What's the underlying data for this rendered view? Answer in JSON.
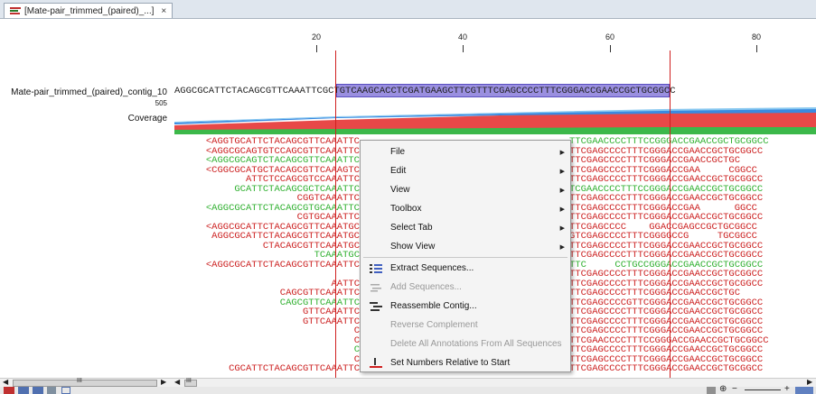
{
  "tab": {
    "title": "[Mate-pair_trimmed_(paired)_...]",
    "close": "×"
  },
  "ruler": {
    "labels": [
      "20",
      "40",
      "60",
      "80"
    ]
  },
  "contig": {
    "name": "Mate-pair_trimmed_(paired)_contig_10",
    "length": "505",
    "sequence": "AGGCGCATTCTACAGCGTTCAAATTCGCTGTCAAGCACCTCGATGAAGCTTCGTTTCGAGCCCCTTTCGGGACCGAACCGCTGCGGCC"
  },
  "coverage_label": "Coverage",
  "reads": [
    {
      "left": "<AGGTGCATTCTACAGCGTTCAAATTC",
      "right": "TTCGAACCCCTTTCCGGGACCGAACCGCTGCGGCC"
    },
    {
      "left": "<AGGCGCAGTGTCCAGCGTTCAAATTC",
      "right": "TTCGAGCCCCTTTCGGGACCGAACCGCTGCGGCC"
    },
    {
      "left": "<AGGCGCAGTCTACAGCGTTCAAATTC",
      "right": "TTCGAGCCCCTTTCGGGACCGAACCGCTGC"
    },
    {
      "left": "<CGGCGCATGCTACAGCGTTCAAAGTC",
      "right": "TTCGAGCCCCTTTCGGGACCGAA     CGGCC"
    },
    {
      "left": "          ATTCTCCAGCGTCCAAATTC",
      "right": "TTCGAGCCCCTTTCGGGACCGAACCGCTGCGGCC"
    },
    {
      "left": "      GCATTCTACAGCGCTCAAATTC",
      "right": "TCGAACCCCTTTCCGGGACCGAACCGCTGCGGCC"
    },
    {
      "left": "                CGGTCAAATTC",
      "right": "TTCGAGCCCCTTTCGGGACCGAACCGCTGCGGCC"
    },
    {
      "left": "<AGGCGCATTCTACAGCGTGCAAATTC",
      "right": "TTCGAGCCCCTTTCGGGACCGAA      GGCC"
    },
    {
      "left": "                CGTGCAAATTC",
      "right": "TTCGAGCCCCTTTCGGGACCGAACCGCTGCGGCC"
    },
    {
      "left": "<AGGCGCATTCTACAGCGTTCAAATGC",
      "right": "TTCGAGCCCC    GGACCGAGCCGCTGCGGCC"
    },
    {
      "left": " AGGCGCATTCTACAGCGTTCAAATGC",
      "right": "GTCGAGCCCCTTTCGGGGCCG     TGCGGCC"
    },
    {
      "left": "        CTACAGCGTTCAAATGC",
      "right": "TTCGAGCCCCTTTCGGGACCGAACCGCTGCGGCC"
    },
    {
      "left": "                 TCAAATGC",
      "right": "TTCGAGCCCCTTTCGGGACCGAACCGCTGCGGCC"
    },
    {
      "left": "<AGGCGCATTCTACAGCGTTCAAATTC",
      "right": "TTC     CCTGCCGGGACCGAACCGCTGCGGCC"
    },
    {
      "left": "",
      "right": "TTCGAGCCCCTTTCGGGACCGAACCGCTGCGGCC"
    },
    {
      "left": "                     AATTC",
      "right": "TTCGAGCCCCTTTCGGGACCGAACCGCTGCGGCC"
    },
    {
      "left": "            CAGCGTTCAAATTC",
      "right": "TTCGAGCCCCTTTCGGGACCGAACCGCTGC"
    },
    {
      "left": "            CAGCGTTCAAATTC",
      "right": "TTCGAGCCCCGTTCGGGACCGAACCGCTGCGGCC"
    },
    {
      "left": "               GTTCAAATTC",
      "right": "TTCGAGCCCCTTTCGGGACCGAACCGCTGCGGCC"
    },
    {
      "left": "               GTTCAAATTC",
      "right": "TTCGAGCCCCTTTCGGGACCGAACCGCTGCGGCC"
    },
    {
      "left": "                        C",
      "right": "TTCGAGCCCCTTTCGGGACCGAACCGCTGCGGCC"
    },
    {
      "left": "                        C",
      "right": "TTCGAACCCCTTTCCGGGACCGAACCGCTGCGGCC"
    },
    {
      "left": "                        C",
      "right": "TTCGAGCCCCTTTCGGGACCGAACCGCTGCGGCC"
    },
    {
      "left": "                        C",
      "right": "TTCGAGCCCCTTTCGGGACCGAACCGCTGCGGCC"
    },
    {
      "left": "       CGCATTCTACAGCGTTCAAATTC",
      "right": "TTCGAGCCCCTTTCGGGACCGAACCGCTGCGGCC"
    }
  ],
  "menu": {
    "file": "File",
    "edit": "Edit",
    "view": "View",
    "toolbox": "Toolbox",
    "select_tab": "Select Tab",
    "show_view": "Show View",
    "extract_sequences": "Extract Sequences...",
    "add_sequences": "Add Sequences...",
    "reassemble_contig": "Reassemble Contig...",
    "reverse_complement": "Reverse Complement",
    "delete_annotations": "Delete All Annotations From All Sequences",
    "set_numbers": "Set Numbers Relative to Start"
  },
  "scroll": {
    "ellipsis": "III"
  },
  "colors": {
    "selection": "#9a8fe0",
    "red_line": "#d02020",
    "read_red": "#cc2020",
    "read_green": "#30b030"
  }
}
